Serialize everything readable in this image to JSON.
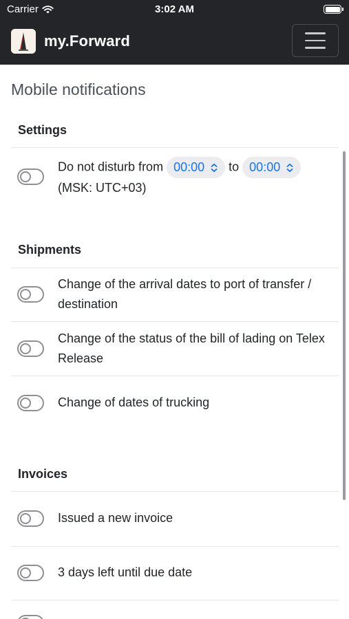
{
  "status_bar": {
    "carrier": "Carrier",
    "time": "3:02 AM"
  },
  "navbar": {
    "brand": "my.Forward"
  },
  "page": {
    "title": "Mobile notifications"
  },
  "settings": {
    "title": "Settings",
    "dnd_prefix": "Do not disturb from",
    "from_time": "00:00",
    "to_word": "to",
    "to_time": "00:00",
    "timezone": "(MSK: UTC+03)",
    "enabled": false
  },
  "shipments": {
    "title": "Shipments",
    "items": [
      {
        "label": "Change of the arrival dates to port of transfer / destination",
        "enabled": false
      },
      {
        "label": "Change of the status of the bill of lading on Telex Release",
        "enabled": false
      },
      {
        "label": "Change of dates of trucking",
        "enabled": false
      }
    ]
  },
  "invoices": {
    "title": "Invoices",
    "items": [
      {
        "label": "Issued a new invoice",
        "enabled": false
      },
      {
        "label": "3 days left until due date",
        "enabled": false
      }
    ]
  },
  "colors": {
    "navbar_bg": "#232528",
    "accent": "#1a73e8",
    "toggle_off": "#8e8e93"
  }
}
